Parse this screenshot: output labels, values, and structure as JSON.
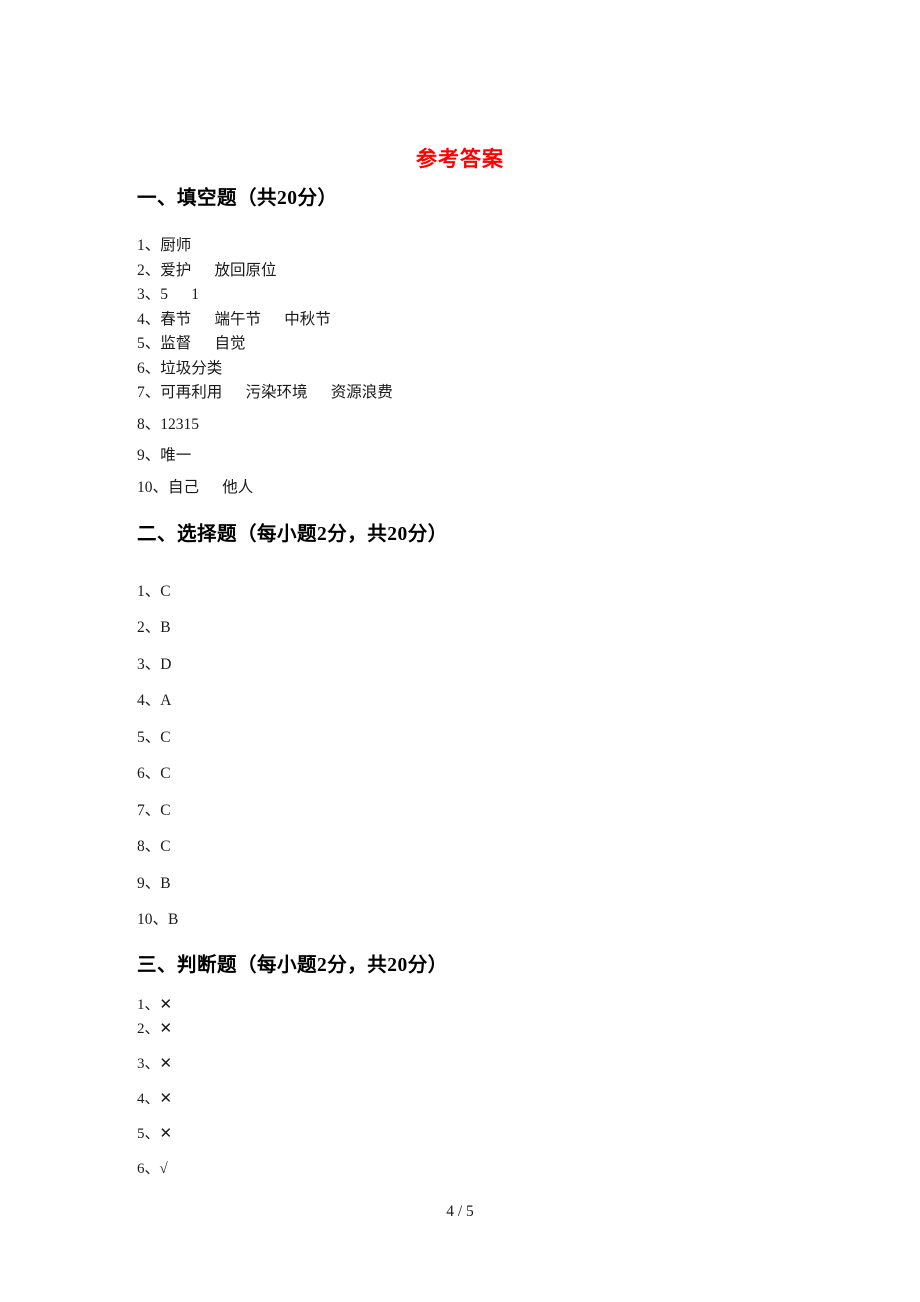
{
  "document": {
    "title": "参考答案",
    "title_color": "#ff0000",
    "footer": "4 / 5"
  },
  "sections": [
    {
      "heading": "一、填空题（共20分）",
      "items": [
        "1、厨师",
        "2、爱护      放回原位",
        "3、5      1",
        "4、春节      端午节      中秋节",
        "5、监督      自觉",
        "6、垃圾分类",
        "7、可再利用      污染环境      资源浪费",
        "8、12315",
        "9、唯一",
        "10、自己      他人"
      ]
    },
    {
      "heading": "二、选择题（每小题2分，共20分）",
      "items": [
        "1、C",
        "2、B",
        "3、D",
        "4、A",
        "5、C",
        "6、C",
        "7、C",
        "8、C",
        "9、B",
        "10、B"
      ]
    },
    {
      "heading": "三、判断题（每小题2分，共20分）",
      "items": [
        "1、✕",
        "2、✕",
        "3、✕",
        "4、✕",
        "5、✕",
        "6、√"
      ]
    }
  ]
}
